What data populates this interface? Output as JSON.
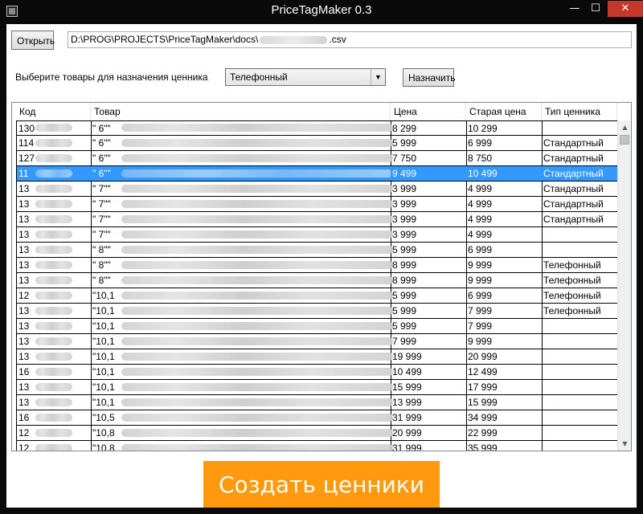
{
  "window": {
    "title": "PriceTagMaker 0.3",
    "min_glyph": "—",
    "max_glyph": "☐",
    "close_glyph": "✕"
  },
  "file": {
    "open_label": "Открыть",
    "path": "D:\\PROG\\PROJECTS\\PriceTagMaker\\docs\\",
    "path_ext": ".csv"
  },
  "assign": {
    "prompt": "Выберите товары для назначения ценника",
    "selected_type": "Телефонный",
    "assign_label": "Назначить"
  },
  "table": {
    "columns": [
      "Код",
      "Товар",
      "Цена",
      "Старая цена",
      "Тип ценника"
    ],
    "rows": [
      {
        "code": "130",
        "name": "\" 6\"\"",
        "price": "8 299",
        "old": "10 299",
        "type": ""
      },
      {
        "code": "114",
        "name": "\" 6\"\"",
        "price": "5 999",
        "old": "6 999",
        "type": "Стандартный"
      },
      {
        "code": "127",
        "name": "\" 6\"\"",
        "price": "7 750",
        "old": "8 750",
        "type": "Стандартный"
      },
      {
        "code": "11",
        "name": "\" 6\"\"",
        "price": "9 499",
        "old": "10 499",
        "type": "Стандартный"
      },
      {
        "code": "13",
        "name": "\" 7\"\"",
        "price": "3 999",
        "old": "4 999",
        "type": "Стандартный"
      },
      {
        "code": "13",
        "name": "\" 7\"\"",
        "price": "3 999",
        "old": "4 999",
        "type": "Стандартный"
      },
      {
        "code": "13",
        "name": "\" 7\"\"",
        "price": "3 999",
        "old": "4 999",
        "type": "Стандартный"
      },
      {
        "code": "13",
        "name": "\" 7\"\"",
        "price": "3 999",
        "old": "4 999",
        "type": ""
      },
      {
        "code": "13",
        "name": "\" 8\"\"",
        "price": "5 999",
        "old": "6 999",
        "type": ""
      },
      {
        "code": "13",
        "name": "\" 8\"\"",
        "price": "8 999",
        "old": "9 999",
        "type": "Телефонный"
      },
      {
        "code": "13",
        "name": "\" 8\"\"",
        "price": "8 999",
        "old": "9 999",
        "type": "Телефонный"
      },
      {
        "code": "12",
        "name": "\"10,1",
        "price": "5 999",
        "old": "6 999",
        "type": "Телефонный"
      },
      {
        "code": "13",
        "name": "\"10,1",
        "price": "5 999",
        "old": "7 999",
        "type": "Телефонный"
      },
      {
        "code": "13",
        "name": "\"10,1",
        "price": "5 999",
        "old": "7 999",
        "type": ""
      },
      {
        "code": "13",
        "name": "\"10,1",
        "price": "7 999",
        "old": "9 999",
        "type": ""
      },
      {
        "code": "13",
        "name": "\"10,1",
        "price": "19 999",
        "old": "20 999",
        "type": ""
      },
      {
        "code": "16",
        "name": "\"10,1",
        "price": "10 499",
        "old": "12 499",
        "type": ""
      },
      {
        "code": "13",
        "name": "\"10,1",
        "price": "15 999",
        "old": "17 999",
        "type": ""
      },
      {
        "code": "13",
        "name": "\"10,1",
        "price": "13 999",
        "old": "15 999",
        "type": ""
      },
      {
        "code": "16",
        "name": "\"10,5",
        "price": "31 999",
        "old": "34 999",
        "type": ""
      },
      {
        "code": "12",
        "name": "\"10,8",
        "price": "20 999",
        "old": "22 999",
        "type": ""
      },
      {
        "code": "12",
        "name": "\"10,8",
        "price": "31 999",
        "old": "35 999",
        "type": ""
      }
    ],
    "selected_row": 3
  },
  "create": {
    "label": "Создать ценники"
  },
  "colors": {
    "accent": "#ff9a0f",
    "selection": "#3399ff",
    "close": "#c7382c"
  }
}
